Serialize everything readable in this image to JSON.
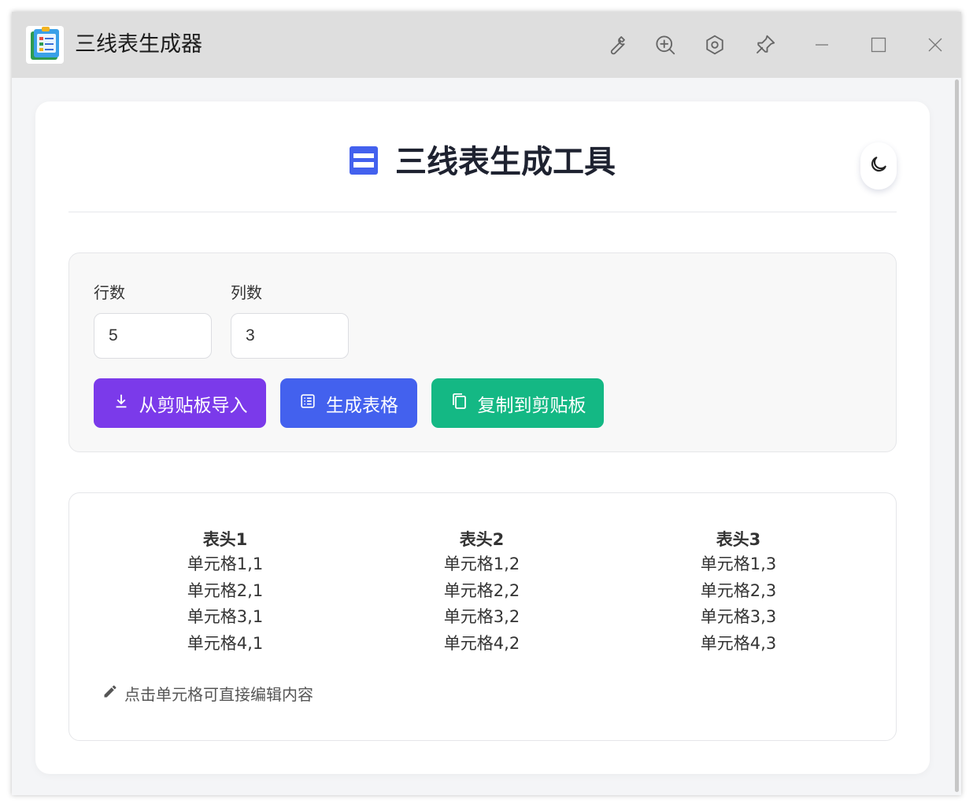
{
  "window": {
    "title": "三线表生成器",
    "controls": [
      "wrench-icon",
      "zoom-in-icon",
      "hexagon-settings-icon",
      "pin-icon",
      "minimize-icon",
      "maximize-icon",
      "close-icon"
    ]
  },
  "page": {
    "title": "三线表生成工具",
    "theme_toggle_icon": "moon-icon"
  },
  "controls": {
    "rows_label": "行数",
    "rows_value": "5",
    "cols_label": "列数",
    "cols_value": "3",
    "import_button": "从剪贴板导入",
    "generate_button": "生成表格",
    "copy_button": "复制到剪贴板"
  },
  "table": {
    "headers": [
      "表头1",
      "表头2",
      "表头3"
    ],
    "rows": [
      [
        "单元格1,1",
        "单元格1,2",
        "单元格1,3"
      ],
      [
        "单元格2,1",
        "单元格2,2",
        "单元格2,3"
      ],
      [
        "单元格3,1",
        "单元格3,2",
        "单元格3,3"
      ],
      [
        "单元格4,1",
        "单元格4,2",
        "单元格4,3"
      ]
    ],
    "hint": "点击单元格可直接编辑内容"
  },
  "colors": {
    "accent_blue": "#4361ee",
    "accent_purple": "#7b3aea",
    "accent_green": "#14b884",
    "title_text": "#1e2230"
  }
}
